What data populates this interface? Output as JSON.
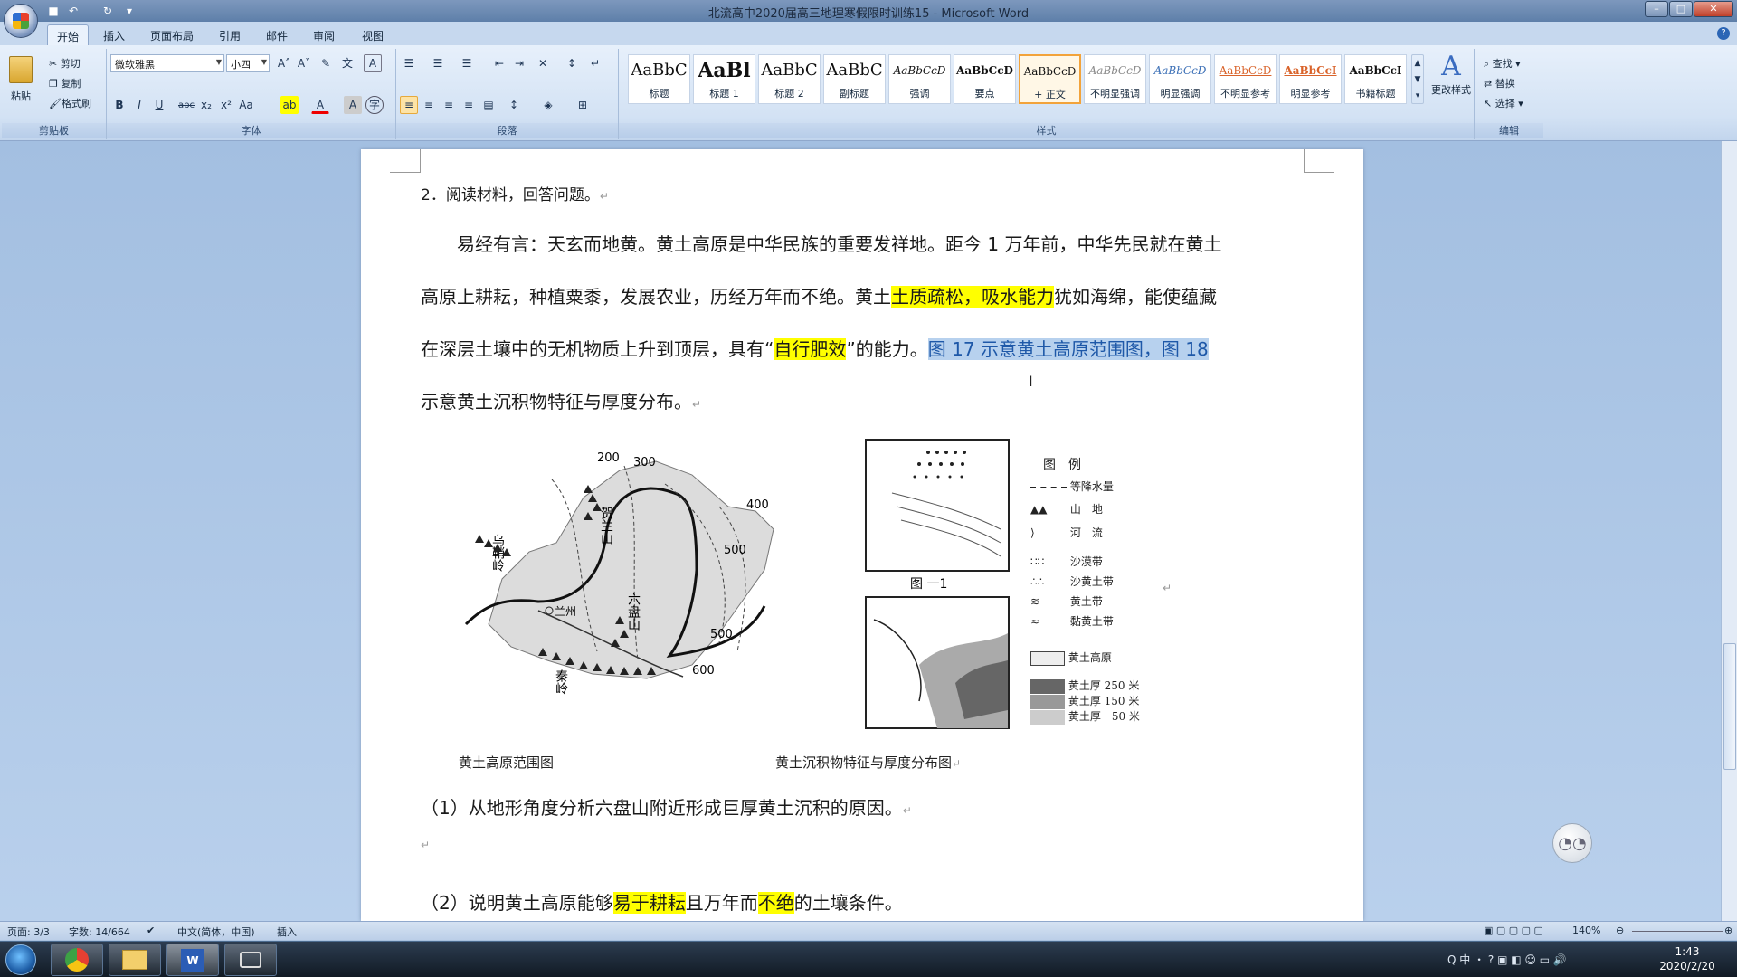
{
  "window": {
    "title": "北流高中2020届高三地理寒假限时训练15 - Microsoft Word"
  },
  "tabs": [
    "开始",
    "插入",
    "页面布局",
    "引用",
    "邮件",
    "审阅",
    "视图"
  ],
  "clipboard": {
    "paste": "粘贴",
    "cut": "剪切",
    "copy": "复制",
    "format_painter": "格式刷",
    "label": "剪贴板"
  },
  "font": {
    "family": "微软雅黑",
    "size": "小四",
    "label": "字体"
  },
  "paragraph": {
    "label": "段落"
  },
  "styles": {
    "label": "样式",
    "items": [
      {
        "preview": "AaBbC",
        "name": "标题"
      },
      {
        "preview": "AaBl",
        "name": "标题 1"
      },
      {
        "preview": "AaBbC",
        "name": "标题 2"
      },
      {
        "preview": "AaBbC",
        "name": "副标题"
      },
      {
        "preview": "AaBbCcD",
        "name": "强调"
      },
      {
        "preview": "AaBbCcD",
        "name": "要点"
      },
      {
        "preview": "AaBbCcD",
        "name": "+ 正文"
      },
      {
        "preview": "AaBbCcD",
        "name": "不明显强调"
      },
      {
        "preview": "AaBbCcD",
        "name": "明显强调"
      },
      {
        "preview": "AaBbCcD",
        "name": "不明显参考"
      },
      {
        "preview": "AaBbCcI",
        "name": "明显参考"
      },
      {
        "preview": "AaBbCcI",
        "name": "书籍标题"
      }
    ],
    "change": "更改样式"
  },
  "editing": {
    "label": "编辑",
    "find": "查找",
    "replace": "替换",
    "select": "选择"
  },
  "doc": {
    "q_header": "2．阅读材料，回答问题。",
    "p1a": "易经有言：天玄而地黄。黄土高原是中华民族的重要发祥地。距今 1 万年前，中华先民就在黄土",
    "p1b_1": "高原上耕耘，种植粟黍，发展农业，历经万年而不绝。黄土",
    "p1b_hl": "土质疏松，吸水能力",
    "p1b_2": "犹如海绵，能使蕴藏",
    "p1c_1": "在深层土壤中的无机物质上升到顶层，具有“",
    "p1c_hl": "自行肥效",
    "p1c_2": "”的能力。",
    "p1c_sel": "图 17 示意黄土高原范围图，图 18",
    "p1d": "示意黄土沉积物特征与厚度分布。",
    "map_labels": {
      "c200": "200",
      "c300": "300",
      "c400": "400",
      "c500a": "500",
      "c500b": "500",
      "c600": "600",
      "helan": "贺兰山",
      "wuqiaoling": "乌鞘岭",
      "lanzhou": "兰州",
      "liupan": "六盘山",
      "qinling": "秦岭",
      "fig1": "图 一1"
    },
    "legend": {
      "title": "图　例",
      "items": [
        "等降水量",
        "山　地",
        "河　流",
        "沙漠带",
        "沙黄土带",
        "黄土带",
        "黏黄土带",
        "黄土高原",
        "黄土厚 250 米",
        "黄土厚 150 米",
        "黄土厚　50 米"
      ]
    },
    "caption_left": "黄土高原范围图",
    "caption_right": "黄土沉积物特征与厚度分布图",
    "q1": "（1）从地形角度分析六盘山附近形成巨厚黄土沉积的原因。",
    "q2_1": "（2）说明黄土高原能够",
    "q2_hl1": "易于耕耘",
    "q2_2": "且万年而",
    "q2_hl2": "不绝",
    "q2_3": "的土壤条件。"
  },
  "status": {
    "page": "页面: 3/3",
    "words": "字数: 14/664",
    "lang": "中文(简体，中国)",
    "mode": "插入",
    "zoom": "140%"
  },
  "clock": {
    "time": "1:43",
    "date": "2020/2/20"
  },
  "colors": {
    "highlight": "#ffff00",
    "selection": "#b7d1ee"
  }
}
